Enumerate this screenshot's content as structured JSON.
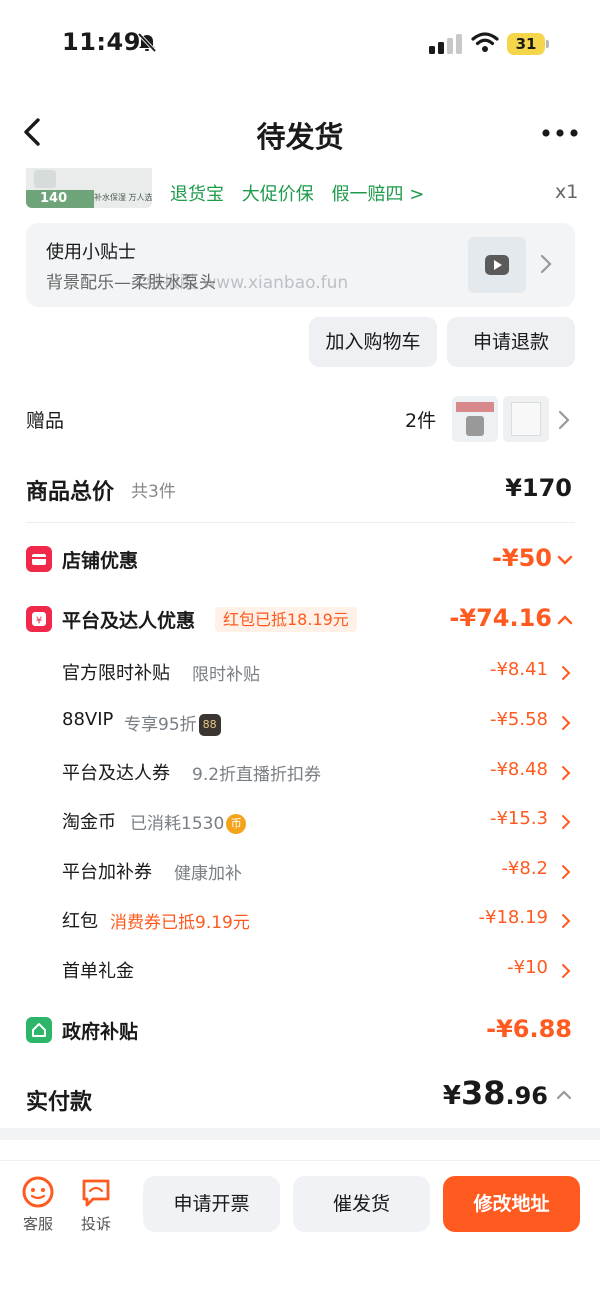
{
  "status_bar": {
    "time": "11:49",
    "battery": "31"
  },
  "nav": {
    "title": "待发货"
  },
  "product": {
    "price_tag": "140",
    "tagline": "补水保湿 万人选择",
    "services": [
      "退货宝",
      "大促价保",
      "假一赔四 >"
    ],
    "quantity": "x1"
  },
  "tip": {
    "title": "使用小贴士",
    "subtitle": "背景配乐—柔肤水泵头",
    "watermark": "线报酷 www.xianbao.fun"
  },
  "actions": {
    "add_to_cart": "加入购物车",
    "request_refund": "申请退款"
  },
  "gift": {
    "label": "赠品",
    "count": "2件"
  },
  "total": {
    "label": "商品总价",
    "count": "共3件",
    "value": "¥170"
  },
  "store_discount": {
    "label": "店铺优惠",
    "value": "-¥50"
  },
  "platform_discount": {
    "label": "平台及达人优惠",
    "badge": "红包已抵18.19元",
    "value": "-¥74.16",
    "items": [
      {
        "name": "官方限时补贴",
        "note": "限时补贴",
        "value": "-¥8.41"
      },
      {
        "name": "88VIP",
        "note": "专享95折",
        "badge": "88",
        "value": "-¥5.58"
      },
      {
        "name": "平台及达人券",
        "note": "9.2折直播折扣券",
        "value": "-¥8.48"
      },
      {
        "name": "淘金币",
        "note": "已消耗1530",
        "badge": "币",
        "value": "-¥15.3"
      },
      {
        "name": "平台加补券",
        "note": "健康加补",
        "value": "-¥8.2"
      },
      {
        "name": "红包",
        "note": "消费券已抵9.19元",
        "value": "-¥18.19"
      },
      {
        "name": "首单礼金",
        "note": "",
        "value": "-¥10"
      }
    ]
  },
  "gov_subsidy": {
    "label": "政府补贴",
    "value": "-¥6.88"
  },
  "paid": {
    "label": "实付款",
    "currency": "¥",
    "integer": "38",
    "decimal": ".96"
  },
  "bottom_bar": {
    "service": "客服",
    "complaint": "投诉",
    "invoice": "申请开票",
    "urge": "催发货",
    "change_address": "修改地址"
  },
  "colors": {
    "accent": "#ff5a1f",
    "service_green": "#1e9a4b",
    "discount_red": "#f0284a",
    "subsidy_green": "#2db66a"
  }
}
